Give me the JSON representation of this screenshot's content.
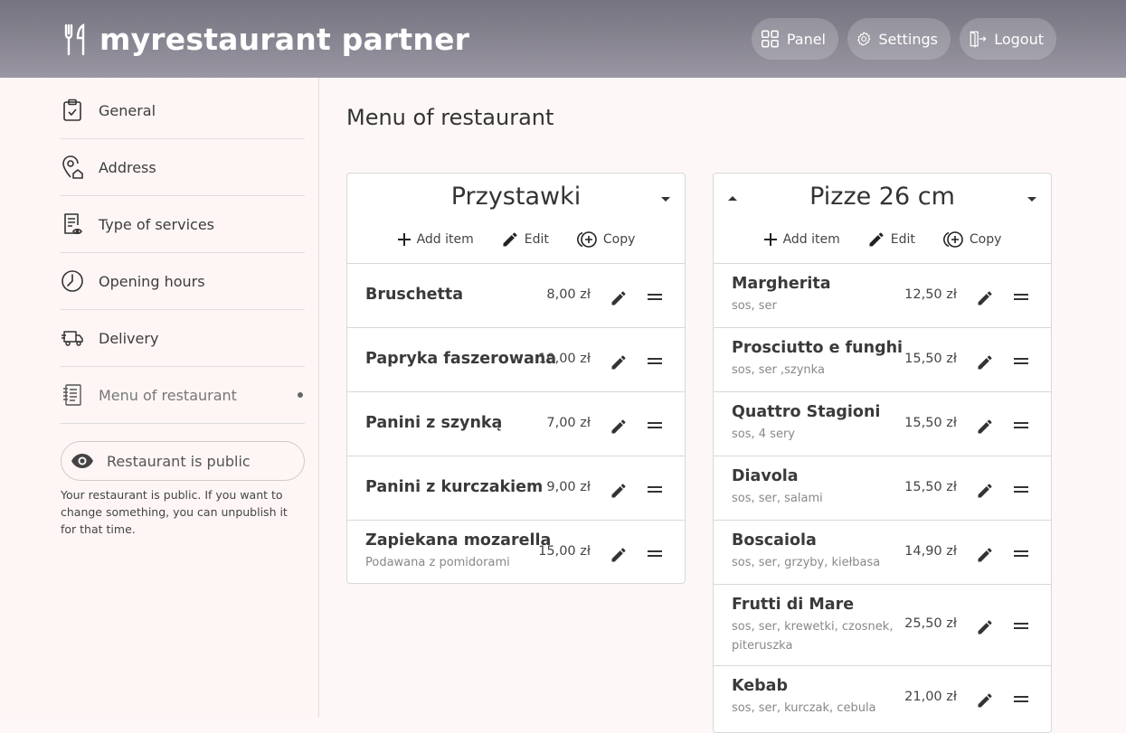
{
  "header": {
    "brand": "myrestaurant partner",
    "panel": "Panel",
    "settings": "Settings",
    "logout": "Logout"
  },
  "sidebar": {
    "items": [
      {
        "label": "General",
        "icon": "clipboard-check-icon"
      },
      {
        "label": "Address",
        "icon": "location-home-icon"
      },
      {
        "label": "Type of services",
        "icon": "document-eye-icon"
      },
      {
        "label": "Opening hours",
        "icon": "clock-icon"
      },
      {
        "label": "Delivery",
        "icon": "delivery-truck-icon"
      },
      {
        "label": "Menu of restaurant",
        "icon": "menu-book-icon",
        "active": true
      }
    ],
    "public_button": "Restaurant is public",
    "public_note": "Your restaurant is public. If you want to change something, you can unpublish it for that time."
  },
  "main": {
    "title": "Menu of restaurant",
    "actions": {
      "add": "Add item",
      "edit": "Edit",
      "copy": "Copy"
    },
    "categories": [
      {
        "title": "Przystawki",
        "items": [
          {
            "name": "Bruschetta",
            "desc": "",
            "price": "8,00 zł"
          },
          {
            "name": "Papryka faszerowana",
            "desc": "",
            "price": "10,00 zł"
          },
          {
            "name": "Panini z szynką",
            "desc": "",
            "price": "7,00 zł"
          },
          {
            "name": "Panini z kurczakiem",
            "desc": "",
            "price": "9,00 zł"
          },
          {
            "name": "Zapiekana mozarella",
            "desc": "Podawana z pomidorami",
            "price": "15,00 zł"
          }
        ]
      },
      {
        "title": "Pizze 26 cm",
        "items": [
          {
            "name": "Margherita",
            "desc": "sos, ser",
            "price": "12,50 zł"
          },
          {
            "name": "Prosciutto e funghi",
            "desc": "sos, ser ,szynka",
            "price": "15,50 zł"
          },
          {
            "name": "Quattro Stagioni",
            "desc": "sos, 4 sery",
            "price": "15,50 zł"
          },
          {
            "name": "Diavola",
            "desc": "sos, ser, salami",
            "price": "15,50 zł"
          },
          {
            "name": "Boscaiola",
            "desc": "sos, ser, grzyby, kiełbasa",
            "price": "14,90 zł"
          },
          {
            "name": "Frutti di Mare",
            "desc": "sos, ser, krewetki, czosnek, piteruszka",
            "price": "25,50 zł"
          },
          {
            "name": "Kebab",
            "desc": "sos, ser, kurczak, cebula",
            "price": "21,00 zł"
          }
        ]
      }
    ]
  }
}
